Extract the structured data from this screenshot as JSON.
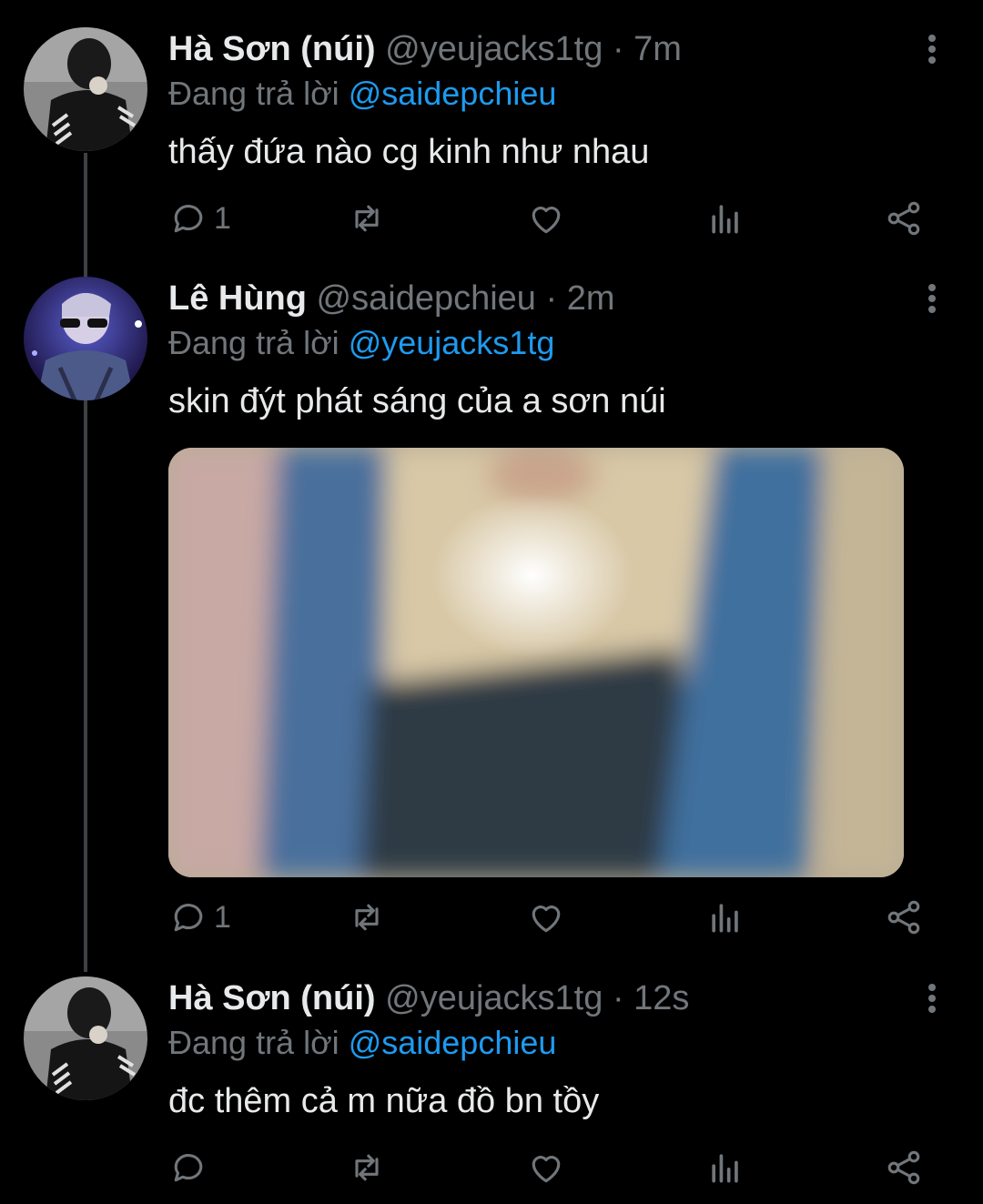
{
  "tweets": [
    {
      "display_name": "Hà Sơn (núi)",
      "handle": "@yeujacks1tg",
      "separator": "·",
      "time": "7m",
      "replying_prefix": "Đang trả lời",
      "replying_to": "@saidepchieu",
      "text": "thấy đứa nào cg kinh như nhau",
      "reply_count": "1"
    },
    {
      "display_name": "Lê Hùng",
      "handle": "@saidepchieu",
      "separator": "·",
      "time": "2m",
      "replying_prefix": "Đang trả lời",
      "replying_to": "@yeujacks1tg",
      "text": "skin đýt phát sáng của a sơn núi",
      "reply_count": "1"
    },
    {
      "display_name": "Hà Sơn (núi)",
      "handle": "@yeujacks1tg",
      "separator": "·",
      "time": "12s",
      "replying_prefix": "Đang trả lời",
      "replying_to": "@saidepchieu",
      "text": "đc thêm cả m nữa đồ bn tồy",
      "reply_count": ""
    }
  ],
  "icons": {
    "reply": "reply-icon",
    "retweet": "retweet-icon",
    "like": "heart-icon",
    "views": "views-icon",
    "share": "share-icon",
    "more": "more-vertical-icon"
  },
  "colors": {
    "background": "#000000",
    "primary_text": "#e7e9ea",
    "secondary_text": "#71767b",
    "accent": "#1d9bf0",
    "thread_line": "#3e4144"
  }
}
